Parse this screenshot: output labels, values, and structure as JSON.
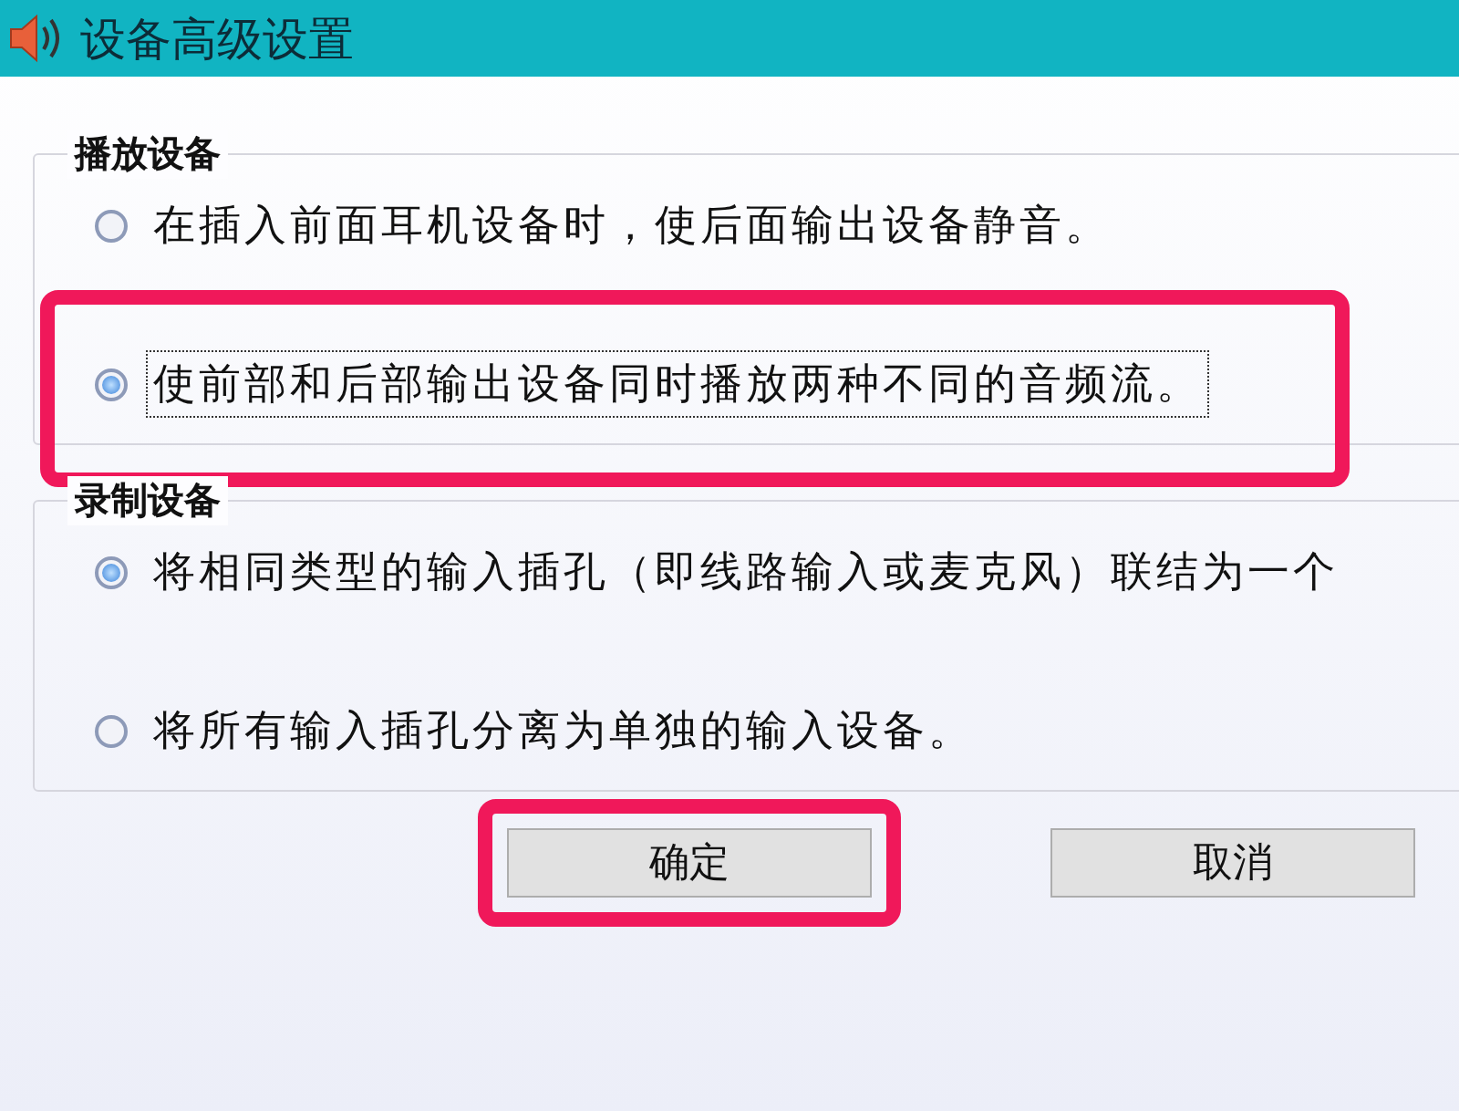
{
  "window": {
    "title": "设备高级设置"
  },
  "groups": [
    {
      "label": "播放设备",
      "options": [
        {
          "label": "在插入前面耳机设备时，使后面输出设备静音。",
          "selected": false,
          "focused": false,
          "highlighted": false
        },
        {
          "label": "使前部和后部输出设备同时播放两种不同的音频流。",
          "selected": true,
          "focused": true,
          "highlighted": true
        }
      ]
    },
    {
      "label": "录制设备",
      "options": [
        {
          "label": "将相同类型的输入插孔（即线路输入或麦克风）联结为一个",
          "selected": true,
          "focused": false,
          "highlighted": false
        },
        {
          "label": "将所有输入插孔分离为单独的输入设备。",
          "selected": false,
          "focused": false,
          "highlighted": false
        }
      ]
    }
  ],
  "buttons": [
    {
      "label": "确定",
      "highlighted": true
    },
    {
      "label": "取消",
      "highlighted": false
    }
  ]
}
